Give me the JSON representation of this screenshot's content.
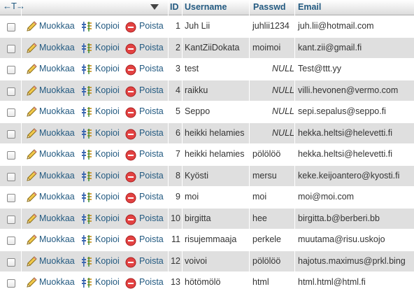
{
  "header": {
    "arrows": "←T→",
    "col_id": "ID",
    "col_username": "Username",
    "col_passwd": "Passwd",
    "col_email": "Email"
  },
  "actions": {
    "edit": "Muokkaa",
    "copy": "Kopioi",
    "delete": "Poista"
  },
  "null_label": "NULL",
  "rows": [
    {
      "id": "1",
      "username": "Juh Lii",
      "passwd": "juhlii1234",
      "email": "juh.lii@hotmail.com"
    },
    {
      "id": "2",
      "username": "KantZiiDokata",
      "passwd": "moimoi",
      "email": "kant.zii@gmail.fi"
    },
    {
      "id": "3",
      "username": "test",
      "passwd": null,
      "email": "Test@ttt.yy"
    },
    {
      "id": "4",
      "username": "raikku",
      "passwd": null,
      "email": "villi.hevonen@vermo.com"
    },
    {
      "id": "5",
      "username": "Seppo",
      "passwd": null,
      "email": "sepi.sepalus@seppo.fi"
    },
    {
      "id": "6",
      "username": "heikki helamies",
      "passwd": null,
      "email": "hekka.heltsi@helevetti.fi"
    },
    {
      "id": "7",
      "username": "heikki helamies",
      "passwd": "pölölöö",
      "email": "hekka.heltsi@helevetti.fi"
    },
    {
      "id": "8",
      "username": "Kyösti",
      "passwd": "mersu",
      "email": "keke.keijoantero@kyosti.fi"
    },
    {
      "id": "9",
      "username": "moi",
      "passwd": "moi",
      "email": "moi@moi.com"
    },
    {
      "id": "10",
      "username": "birgitta",
      "passwd": "hee",
      "email": "birgitta.b@berberi.bb"
    },
    {
      "id": "11",
      "username": "risujemmaaja",
      "passwd": "perkele",
      "email": "muutama@risu.uskojo"
    },
    {
      "id": "12",
      "username": "voivoi",
      "passwd": "pölölöö",
      "email": "hajotus.maximus@prkl.bing"
    },
    {
      "id": "13",
      "username": "hötömölö",
      "passwd": "html",
      "email": "html.html@html.fi"
    }
  ]
}
